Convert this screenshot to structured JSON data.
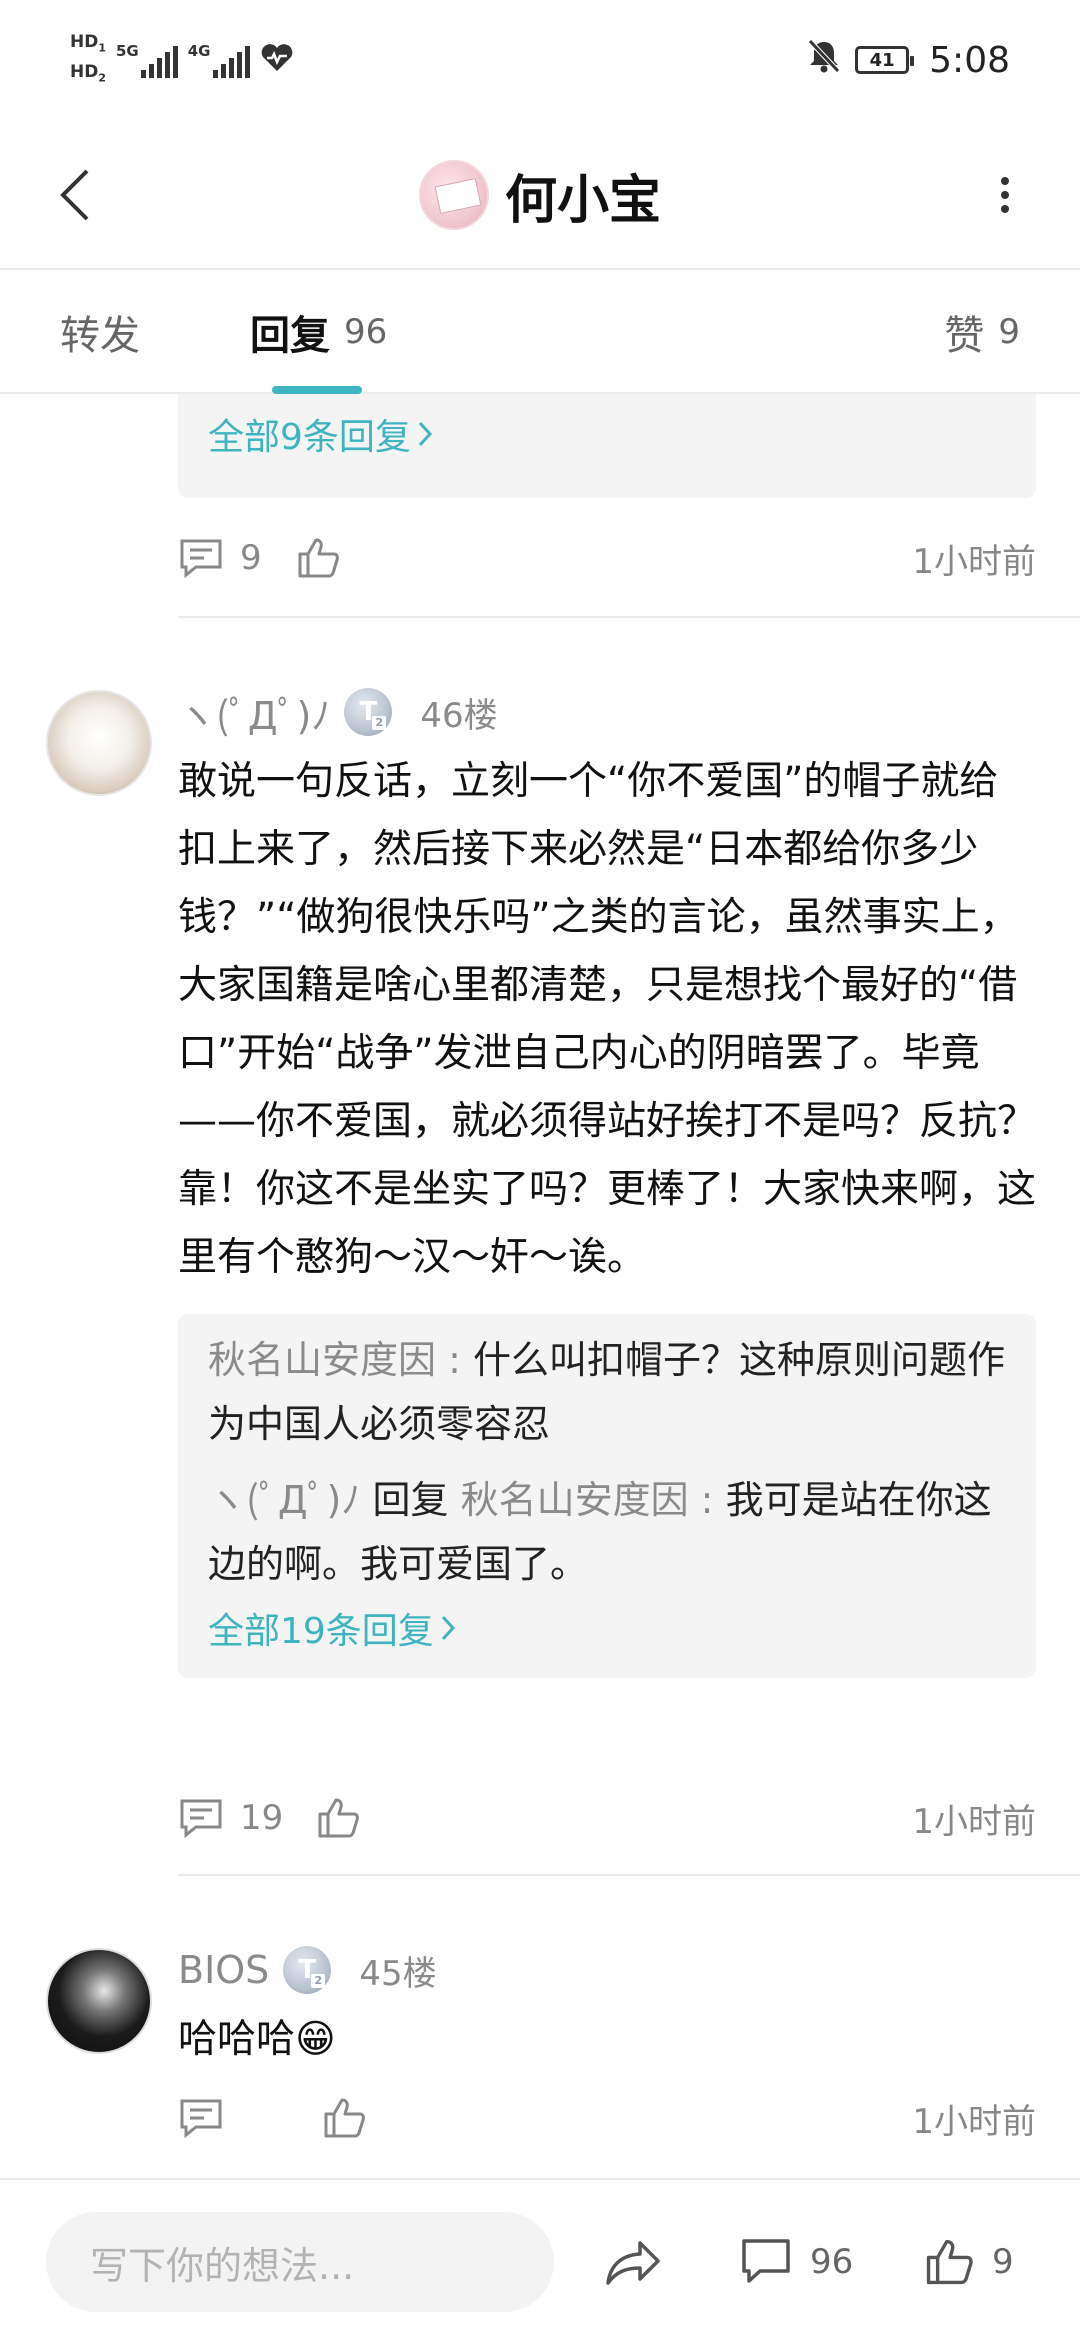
{
  "status_bar": {
    "hd1": "HD",
    "hd1_sub": "1",
    "hd2": "HD",
    "hd2_sub": "2",
    "net1": "5G",
    "net2": "4G",
    "battery": "41",
    "time": "5:08",
    "icons": [
      "signal-icon",
      "heart-health-icon",
      "mute-bell-icon",
      "battery-icon"
    ]
  },
  "header": {
    "title": "何小宝",
    "back_icon": "chevron-left-icon",
    "more_icon": "more-vertical-icon"
  },
  "tabs": {
    "forward_label": "转发",
    "reply_label": "回复",
    "reply_count": "96",
    "like_label": "赞",
    "like_count": "9",
    "accent_color": "#3eb4c0"
  },
  "prev_comment": {
    "all_replies": "全部9条回复",
    "comment_count": "9",
    "time": "1小时前"
  },
  "comments": [
    {
      "username": "ヽ(ﾟДﾟ)ﾉ",
      "badge": "T",
      "floor": "46楼",
      "text": "敢说一句反话，立刻一个“你不爱国”的帽子就给扣上来了，然后接下来必然是“日本都给你多少钱？”“做狗很快乐吗”之类的言论，虽然事实上，大家国籍是啥心里都清楚，只是想找个最好的“借口”开始“战争”发泄自己内心的阴暗罢了。毕竟——你不爱国，就必须得站好挨打不是吗？反抗？靠！你这不是坐实了吗？更棒了！大家快来啊，这里有个憨狗～汉～奸～诶。",
      "replies": [
        {
          "user": "秋名山安度因",
          "sep": ":",
          "text": "什么叫扣帽子？这种原则问题作为中国人必须零容忍"
        },
        {
          "user": "ヽ(ﾟДﾟ)ﾉ",
          "reply_word": "回复",
          "target": "秋名山安度因",
          "sep": ":",
          "text": "我可是站在你这边的啊。我可爱国了。"
        }
      ],
      "all_replies": "全部19条回复",
      "comment_count": "19",
      "time": "1小时前"
    },
    {
      "username": "BIOS",
      "badge": "T",
      "floor": "45楼",
      "text": "哈哈哈😁",
      "time": "1小时前"
    }
  ],
  "bottom_bar": {
    "placeholder": "写下你的想法...",
    "comment_count": "96",
    "like_count": "9"
  }
}
